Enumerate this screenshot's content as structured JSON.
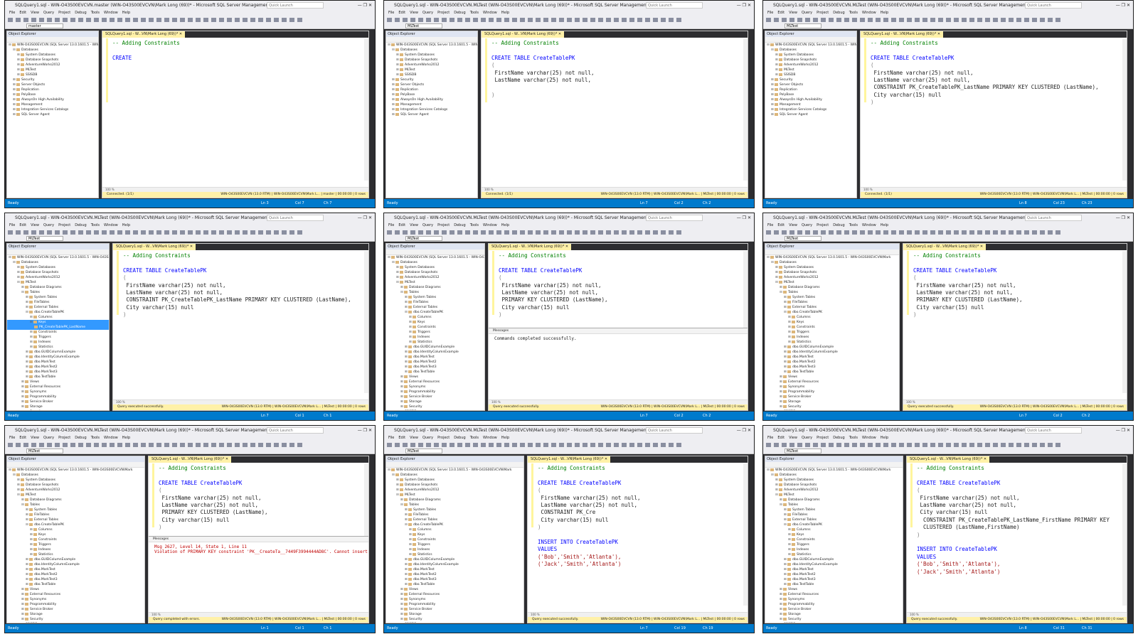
{
  "app": {
    "title_master": "SQLQuery1.sql - WIN-O43S00EVCVN.master (WIN-O43S00EVCVN\\Mark Long (69))* - Microsoft SQL Server Management Studio",
    "title_mltest": "SQLQuery1.sql - WIN-O43S00EVCVN.MLTest (WIN-O43S00EVCVN\\Mark Long (69))* - Microsoft SQL Server Management Studio",
    "quick_launch": "Quick Launch",
    "window_controls": "—  ❐  ✕",
    "menu": [
      "File",
      "Edit",
      "View",
      "Query",
      "Project",
      "Debug",
      "Tools",
      "Window",
      "Help"
    ],
    "db_master": "master",
    "db_mltest": "MLTest"
  },
  "explorer": {
    "header": "Object Explorer",
    "nodes_short": [
      {
        "text": "WIN-O43S00EVCVN (SQL Server 13.0.1601.5 - WIN-O43S00EVCVN\\Mark",
        "exp": "⊟",
        "lvl": 0
      },
      {
        "text": "Databases",
        "exp": "⊟",
        "lvl": 1
      },
      {
        "text": "System Databases",
        "exp": "⊞",
        "lvl": 2
      },
      {
        "text": "Database Snapshots",
        "exp": "⊞",
        "lvl": 2
      },
      {
        "text": "AdventureWorks2012",
        "exp": "⊞",
        "lvl": 2
      },
      {
        "text": "MLTest",
        "exp": "⊞",
        "lvl": 2
      },
      {
        "text": "SSISDB",
        "exp": "⊞",
        "lvl": 2
      },
      {
        "text": "Security",
        "exp": "⊞",
        "lvl": 1
      },
      {
        "text": "Server Objects",
        "exp": "⊞",
        "lvl": 1
      },
      {
        "text": "Replication",
        "exp": "⊞",
        "lvl": 1
      },
      {
        "text": "PolyBase",
        "exp": "⊞",
        "lvl": 1
      },
      {
        "text": "AlwaysOn High Availability",
        "exp": "⊞",
        "lvl": 1
      },
      {
        "text": "Management",
        "exp": "⊞",
        "lvl": 1
      },
      {
        "text": "Integration Services Catalogs",
        "exp": "⊞",
        "lvl": 1
      },
      {
        "text": "SQL Server Agent",
        "exp": "⊞",
        "lvl": 1
      }
    ],
    "nodes_long": [
      {
        "text": "WIN-O43S00EVCVN (SQL Server 13.0.1601.5 - WIN-O43S00EVCVN\\Mark",
        "exp": "⊟",
        "lvl": 0
      },
      {
        "text": "Databases",
        "exp": "⊟",
        "lvl": 1
      },
      {
        "text": "System Databases",
        "exp": "⊞",
        "lvl": 2
      },
      {
        "text": "Database Snapshots",
        "exp": "⊞",
        "lvl": 2
      },
      {
        "text": "AdventureWorks2012",
        "exp": "⊞",
        "lvl": 2
      },
      {
        "text": "MLTest",
        "exp": "⊟",
        "lvl": 2
      },
      {
        "text": "Database Diagrams",
        "exp": "⊞",
        "lvl": 3
      },
      {
        "text": "Tables",
        "exp": "⊟",
        "lvl": 3
      },
      {
        "text": "System Tables",
        "exp": "⊞",
        "lvl": 4
      },
      {
        "text": "FileTables",
        "exp": "⊞",
        "lvl": 4
      },
      {
        "text": "External Tables",
        "exp": "⊞",
        "lvl": 4
      },
      {
        "text": "dbo.CreateTablePK",
        "exp": "⊟",
        "lvl": 4
      },
      {
        "text": "Columns",
        "exp": "⊞",
        "lvl": 5
      },
      {
        "text": "Keys",
        "exp": "⊞",
        "lvl": 5
      },
      {
        "text": "Constraints",
        "exp": "⊞",
        "lvl": 5
      },
      {
        "text": "Triggers",
        "exp": "⊞",
        "lvl": 5
      },
      {
        "text": "Indexes",
        "exp": "⊞",
        "lvl": 5
      },
      {
        "text": "Statistics",
        "exp": "⊞",
        "lvl": 5
      },
      {
        "text": "dbo.GUIDColumnExample",
        "exp": "⊞",
        "lvl": 4
      },
      {
        "text": "dbo.IdentityColumnExample",
        "exp": "⊞",
        "lvl": 4
      },
      {
        "text": "dbo.MarkTest",
        "exp": "⊞",
        "lvl": 4
      },
      {
        "text": "dbo.MarkTest2",
        "exp": "⊞",
        "lvl": 4
      },
      {
        "text": "dbo.MarkTest3",
        "exp": "⊞",
        "lvl": 4
      },
      {
        "text": "dbo.TestTable",
        "exp": "⊞",
        "lvl": 4
      },
      {
        "text": "Views",
        "exp": "⊞",
        "lvl": 3
      },
      {
        "text": "External Resources",
        "exp": "⊞",
        "lvl": 3
      },
      {
        "text": "Synonyms",
        "exp": "⊞",
        "lvl": 3
      },
      {
        "text": "Programmability",
        "exp": "⊞",
        "lvl": 3
      },
      {
        "text": "Service Broker",
        "exp": "⊞",
        "lvl": 3
      },
      {
        "text": "Storage",
        "exp": "⊞",
        "lvl": 3
      },
      {
        "text": "Security",
        "exp": "⊞",
        "lvl": 3
      },
      {
        "text": "SSISDB",
        "exp": "⊞",
        "lvl": 2
      },
      {
        "text": "Security",
        "exp": "⊞",
        "lvl": 1
      },
      {
        "text": "Server Objects",
        "exp": "⊞",
        "lvl": 1
      },
      {
        "text": "Replication",
        "exp": "⊞",
        "lvl": 1
      }
    ],
    "selected_key": "PK_CreateTablePK_LastName"
  },
  "tab": {
    "label": "SQLQuery1.sql - W...VN\\Mark Long (69))*",
    "close": "✕"
  },
  "panels": [
    {
      "title": "title_master",
      "db": "db_master",
      "explorer_w": 130,
      "code": [
        {
          "t": "-- Adding Constraints",
          "c": "cmt"
        },
        {
          "t": "",
          "c": ""
        },
        {
          "t": "CREATE",
          "c": "kw"
        }
      ],
      "msg": null,
      "qstatus": "Connected. (1/1)",
      "status": "Ready",
      "ln": "Ln 3",
      "col": "Col 7",
      "ch": "Ch 7"
    },
    {
      "title": "title_mltest",
      "db": "db_mltest",
      "explorer_w": 130,
      "code": [
        {
          "t": "-- Adding Constraints",
          "c": "cmt"
        },
        {
          "t": "",
          "c": ""
        },
        {
          "t": "CREATE TABLE CreateTablePK",
          "c": "kw"
        },
        {
          "t": "(",
          "c": "gr"
        },
        {
          "t": " FirstName varchar(25) not null,",
          "c": ""
        },
        {
          "t": " LastName varchar(25) not null,",
          "c": ""
        },
        {
          "t": "",
          "c": ""
        },
        {
          "t": ")",
          "c": "gr"
        }
      ],
      "msg": null,
      "qstatus": "Connected. (1/1)",
      "status": "Ready",
      "ln": "Ln 7",
      "col": "Col 2",
      "ch": "Ch 2"
    },
    {
      "title": "title_mltest",
      "db": "db_mltest",
      "explorer_w": 130,
      "code": [
        {
          "t": "-- Adding Constraints",
          "c": "cmt"
        },
        {
          "t": "",
          "c": ""
        },
        {
          "t": "CREATE TABLE CreateTablePK",
          "c": "kw"
        },
        {
          "t": "(",
          "c": "gr"
        },
        {
          "t": " FirstName varchar(25) not null,",
          "c": ""
        },
        {
          "t": " LastName varchar(25) not null,",
          "c": ""
        },
        {
          "t": " CONSTRAINT PK_CreateTablePK_LastName PRIMARY KEY CLUSTERED (LastName),",
          "c": ""
        },
        {
          "t": " City varchar(15) null",
          "c": ""
        },
        {
          "t": ")",
          "c": "gr"
        }
      ],
      "msg": null,
      "qstatus": "Connected. (1/1)",
      "status": "Ready",
      "ln": "Ln 8",
      "col": "Col 23",
      "ch": "Ch 23"
    },
    {
      "title": "title_mltest",
      "db": "db_mltest",
      "explorer_w": 145,
      "code": [
        {
          "t": "-- Adding Constraints",
          "c": "cmt"
        },
        {
          "t": "",
          "c": ""
        },
        {
          "t": "CREATE TABLE CreateTablePK",
          "c": "kw"
        },
        {
          "t": "(",
          "c": "gr"
        },
        {
          "t": " FirstName varchar(25) not null,",
          "c": ""
        },
        {
          "t": " LastName varchar(25) not null,",
          "c": ""
        },
        {
          "t": " CONSTRAINT PK_CreateTablePK_LastName PRIMARY KEY CLUSTERED (LastName),",
          "c": ""
        },
        {
          "t": " City varchar(15) null",
          "c": ""
        },
        {
          "t": ")",
          "c": "gr"
        }
      ],
      "msg": null,
      "qstatus": "Query executed successfully.",
      "status": "Ready",
      "ln": "Ln 7",
      "col": "Col 1",
      "ch": "Ch 1",
      "selected": true
    },
    {
      "title": "title_mltest",
      "db": "db_mltest",
      "explorer_w": 140,
      "code": [
        {
          "t": "-- Adding Constraints",
          "c": "cmt"
        },
        {
          "t": "",
          "c": ""
        },
        {
          "t": "CREATE TABLE CreateTablePK",
          "c": "kw"
        },
        {
          "t": "(",
          "c": "gr"
        },
        {
          "t": " FirstName varchar(25) not null,",
          "c": ""
        },
        {
          "t": " LastName varchar(25) not null,",
          "c": ""
        },
        {
          "t": " PRIMARY KEY CLUSTERED (LastName),",
          "c": ""
        },
        {
          "t": " City varchar(15) null",
          "c": ""
        },
        {
          "t": ")",
          "c": "gr"
        }
      ],
      "msg": {
        "tab": "Messages",
        "text": "Commands completed successfully."
      },
      "qstatus": "Query executed successfully.",
      "status": "Ready",
      "ln": "Ln 7",
      "col": "Col 2",
      "ch": "Ch 2"
    },
    {
      "title": "title_mltest",
      "db": "db_mltest",
      "explorer_w": 190,
      "code": [
        {
          "t": "-- Adding Constraints",
          "c": "cmt"
        },
        {
          "t": "",
          "c": ""
        },
        {
          "t": "CREATE TABLE CreateTablePK",
          "c": "kw"
        },
        {
          "t": "(",
          "c": "gr"
        },
        {
          "t": " FirstName varchar(25) not null,",
          "c": ""
        },
        {
          "t": " LastName varchar(25) not null,",
          "c": ""
        },
        {
          "t": " PRIMARY KEY CLUSTERED (LastName),",
          "c": ""
        },
        {
          "t": " City varchar(15) null",
          "c": ""
        },
        {
          "t": ")",
          "c": "gr"
        }
      ],
      "msg": null,
      "qstatus": "Query executed successfully.",
      "status": "Ready",
      "ln": "Ln 7",
      "col": "Col 2",
      "ch": "Ch 2"
    },
    {
      "title": "title_mltest",
      "db": "db_mltest",
      "explorer_w": 195,
      "code": [
        {
          "t": "-- Adding Constraints",
          "c": "cmt"
        },
        {
          "t": "",
          "c": ""
        },
        {
          "t": "CREATE TABLE CreateTablePK",
          "c": "kw"
        },
        {
          "t": "(",
          "c": "gr"
        },
        {
          "t": " FirstName varchar(25) not null,",
          "c": ""
        },
        {
          "t": " LastName varchar(25) not null,",
          "c": ""
        },
        {
          "t": " PRIMARY KEY CLUSTERED (LastName),",
          "c": ""
        },
        {
          "t": " City varchar(15) null",
          "c": ""
        },
        {
          "t": ")",
          "c": "gr"
        }
      ],
      "msg": {
        "tab": "Messages",
        "text": "Msg 2627, Level 14, State 1, Line 11\nViolation of PRIMARY KEY constraint 'PK__CreateTa__7449F3994444AD8C'. Cannot insert duplic",
        "err": true
      },
      "qstatus": "Query completed with errors.",
      "status": "Ready",
      "ln": "Ln 1",
      "col": "Col 1",
      "ch": "Ch 1"
    },
    {
      "title": "title_mltest",
      "db": "db_mltest",
      "explorer_w": 195,
      "code": [
        {
          "t": "-- Adding Constraints",
          "c": "cmt"
        },
        {
          "t": "",
          "c": ""
        },
        {
          "t": "CREATE TABLE CreateTablePK",
          "c": "kw"
        },
        {
          "t": "(",
          "c": "gr"
        },
        {
          "t": " FirstName varchar(25) not null,",
          "c": ""
        },
        {
          "t": " LastName varchar(25) not null,",
          "c": ""
        },
        {
          "t": " CONSTRAINT PK_Cre",
          "c": ""
        },
        {
          "t": " City varchar(15) null",
          "c": ""
        },
        {
          "t": ")",
          "c": "gr"
        },
        {
          "t": "",
          "c": ""
        },
        {
          "t": "INSERT INTO CreateTablePK",
          "c": "kw"
        },
        {
          "t": "VALUES",
          "c": "kw"
        },
        {
          "t": "('Bob','Smith','Atlanta'),",
          "c": "str"
        },
        {
          "t": "('Jack','Smith','Atlanta')",
          "c": "str"
        }
      ],
      "msg": null,
      "qstatus": "Query executed successfully.",
      "status": "Ready",
      "ln": "Ln 7",
      "col": "Col 19",
      "ch": "Ch 19"
    },
    {
      "title": "title_mltest",
      "db": "db_mltest",
      "explorer_w": 195,
      "code": [
        {
          "t": "-- Adding Constraints",
          "c": "cmt"
        },
        {
          "t": "",
          "c": ""
        },
        {
          "t": "CREATE TABLE CreateTablePK",
          "c": "kw"
        },
        {
          "t": "(",
          "c": "gr"
        },
        {
          "t": " FirstName varchar(25) not null,",
          "c": ""
        },
        {
          "t": " LastName varchar(25) not null,",
          "c": ""
        },
        {
          "t": " City varchar(15) null",
          "c": ""
        },
        {
          "t": "  CONSTRAINT PK_CreateTablePK_LastName_FirstName PRIMARY KEY",
          "c": ""
        },
        {
          "t": "  CLUSTERED (LastName,FirstName)",
          "c": ""
        },
        {
          "t": ")",
          "c": "gr"
        },
        {
          "t": "",
          "c": ""
        },
        {
          "t": "INSERT INTO CreateTablePK",
          "c": "kw"
        },
        {
          "t": "VALUES",
          "c": "kw"
        },
        {
          "t": "('Bob','Smith','Atlanta'),",
          "c": "str"
        },
        {
          "t": "('Jack','Smith','Atlanta')",
          "c": "str"
        }
      ],
      "msg": null,
      "qstatus": "Query executed successfully.",
      "status": "Ready",
      "ln": "Ln 8",
      "col": "Col 31",
      "ch": "Ch 31"
    }
  ],
  "status_server": "WIN-O43S00EVCVN (13.0 RTM)",
  "status_user": "WIN-O43S00EVCVN\\Mark L...",
  "status_time": "00:00:00",
  "status_rows": "0 rows",
  "zoom": "100 %",
  "colors": {
    "accent": "#007acc",
    "tab_yellow": "#fff1a8",
    "comment": "#008000",
    "keyword": "#0000ff"
  }
}
